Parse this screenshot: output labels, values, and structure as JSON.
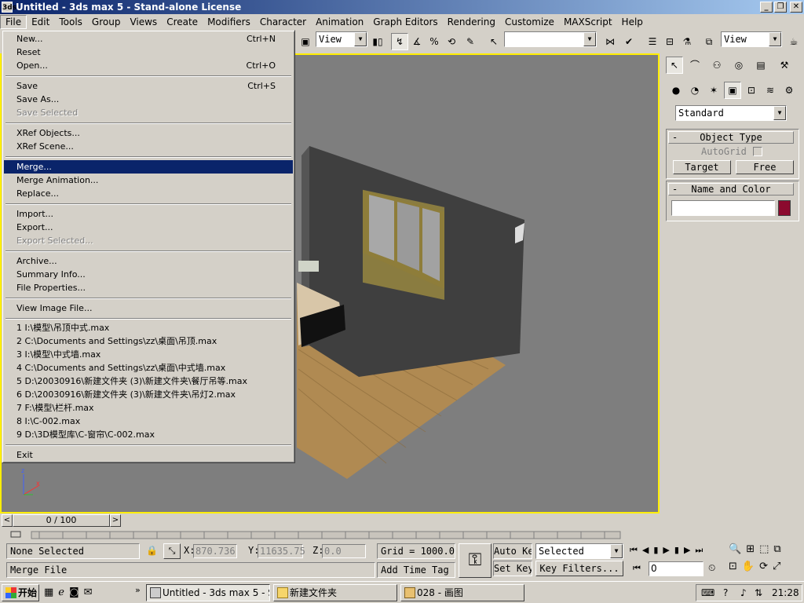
{
  "window": {
    "title": "Untitled - 3ds max 5 - Stand-alone License",
    "icon_label": "3ds"
  },
  "menubar": {
    "items": [
      "File",
      "Edit",
      "Tools",
      "Group",
      "Views",
      "Create",
      "Modifiers",
      "Character",
      "Animation",
      "Graph Editors",
      "Rendering",
      "Customize",
      "MAXScript",
      "Help"
    ]
  },
  "file_menu": {
    "items": [
      {
        "label": "New...",
        "shortcut": "Ctrl+N"
      },
      {
        "label": "Reset",
        "shortcut": ""
      },
      {
        "label": "Open...",
        "shortcut": "Ctrl+O"
      },
      {
        "label": "Save",
        "shortcut": "Ctrl+S"
      },
      {
        "label": "Save As...",
        "shortcut": ""
      },
      {
        "label": "Save Selected",
        "shortcut": ""
      },
      {
        "label": "XRef Objects...",
        "shortcut": ""
      },
      {
        "label": "XRef Scene...",
        "shortcut": ""
      },
      {
        "label": "Merge...",
        "shortcut": ""
      },
      {
        "label": "Merge Animation...",
        "shortcut": ""
      },
      {
        "label": "Replace...",
        "shortcut": ""
      },
      {
        "label": "Import...",
        "shortcut": ""
      },
      {
        "label": "Export...",
        "shortcut": ""
      },
      {
        "label": "Export Selected...",
        "shortcut": ""
      },
      {
        "label": "Archive...",
        "shortcut": ""
      },
      {
        "label": "Summary Info...",
        "shortcut": ""
      },
      {
        "label": "File Properties...",
        "shortcut": ""
      },
      {
        "label": "View Image File...",
        "shortcut": ""
      },
      {
        "label": "1 I:\\模型\\吊顶中式.max",
        "shortcut": ""
      },
      {
        "label": "2 C:\\Documents and Settings\\zz\\桌面\\吊顶.max",
        "shortcut": ""
      },
      {
        "label": "3 I:\\模型\\中式墙.max",
        "shortcut": ""
      },
      {
        "label": "4 C:\\Documents and Settings\\zz\\桌面\\中式墙.max",
        "shortcut": ""
      },
      {
        "label": "5 D:\\20030916\\新建文件夹 (3)\\新建文件夹\\餐厅吊等.max",
        "shortcut": ""
      },
      {
        "label": "6 D:\\20030916\\新建文件夹 (3)\\新建文件夹\\吊灯2.max",
        "shortcut": ""
      },
      {
        "label": "7 F:\\模型\\栏杆.max",
        "shortcut": ""
      },
      {
        "label": "8 I:\\C-002.max",
        "shortcut": ""
      },
      {
        "label": "9 D:\\3D模型库\\C-窗帘\\C-002.max",
        "shortcut": ""
      },
      {
        "label": "Exit",
        "shortcut": ""
      }
    ]
  },
  "toolbar": {
    "ref_coord": "View",
    "named_selection": "",
    "viewport_view": "View"
  },
  "command_panel": {
    "category": "Standard",
    "object_type": {
      "title": "Object Type",
      "autogrid": "AutoGrid",
      "buttons": [
        "Target",
        "Free"
      ]
    },
    "name_color": {
      "title": "Name and Color",
      "name_value": "",
      "color": "#8c0a2e"
    }
  },
  "timeline": {
    "frame": "0 / 100"
  },
  "status": {
    "selection": "None Selected",
    "prompt": "Merge File",
    "x_label": "X:",
    "x_value": "870.736",
    "y_label": "Y:",
    "y_value": "11635.75",
    "z_label": "Z:",
    "z_value": "0.0",
    "grid": "Grid = 1000.0",
    "add_time_tag": "Add Time Tag",
    "auto_key": "Auto Key",
    "set_key": "Set Key",
    "key_mode": "Selected",
    "key_filters": "Key Filters...",
    "current_frame": "0"
  },
  "taskbar": {
    "start": "开始",
    "tasks": [
      "Untitled - 3ds max 5 - St...",
      "新建文件夹",
      "028 - 画图"
    ],
    "clock": "21:28"
  }
}
